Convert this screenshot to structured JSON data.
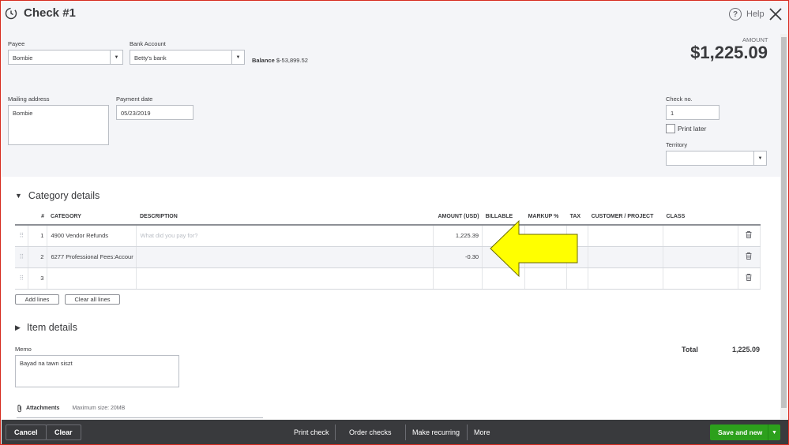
{
  "window": {
    "title": "Check #1",
    "help_label": "Help"
  },
  "payee": {
    "label": "Payee",
    "value": "Bombie"
  },
  "bank_account": {
    "label": "Bank Account",
    "value": "Betty's bank"
  },
  "balance": {
    "label": "Balance",
    "value": "$-53,899.52"
  },
  "amount": {
    "label": "AMOUNT",
    "value": "$1,225.09"
  },
  "mailing_address": {
    "label": "Mailing address",
    "value": "Bombie"
  },
  "payment_date": {
    "label": "Payment date",
    "value": "05/23/2019"
  },
  "check_no": {
    "label": "Check no.",
    "value": "1"
  },
  "print_later": {
    "label": "Print later",
    "checked": false
  },
  "territory": {
    "label": "Territory",
    "value": ""
  },
  "category_details": {
    "title": "Category details",
    "columns": [
      "#",
      "CATEGORY",
      "DESCRIPTION",
      "AMOUNT (USD)",
      "BILLABLE",
      "MARKUP %",
      "TAX",
      "CUSTOMER / PROJECT",
      "CLASS"
    ],
    "rows": [
      {
        "num": "1",
        "category": "4900 Vendor Refunds",
        "description": "",
        "description_placeholder": "What did you pay for?",
        "amount": "1,225.39"
      },
      {
        "num": "2",
        "category": "6277 Professional Fees:Accour",
        "description": "",
        "amount": "-0.30"
      },
      {
        "num": "3",
        "category": "",
        "description": "",
        "amount": ""
      }
    ],
    "add_lines_label": "Add lines",
    "clear_all_lines_label": "Clear all lines"
  },
  "item_details": {
    "title": "Item details"
  },
  "memo": {
    "label": "Memo",
    "value": "Bayad na tawn siszt"
  },
  "total": {
    "label": "Total",
    "value": "1,225.09"
  },
  "attachments": {
    "label": "Attachments",
    "max_size": "Maximum size: 20MB"
  },
  "footer": {
    "cancel": "Cancel",
    "clear": "Clear",
    "print_check": "Print check",
    "order_checks": "Order checks",
    "make_recurring": "Make recurring",
    "more": "More",
    "save_and_new": "Save and new"
  },
  "colors": {
    "accent_green": "#2ca01c",
    "footer_bg": "#393a3d",
    "header_bg": "#f4f5f8",
    "annotation_arrow": "#ffff00"
  },
  "icons": [
    "history-clock-icon",
    "help-circle-icon",
    "close-icon",
    "chevron-down-icon",
    "drag-handle-icon",
    "trash-icon",
    "paperclip-icon",
    "caret-down-icon",
    "annotation-arrow"
  ]
}
